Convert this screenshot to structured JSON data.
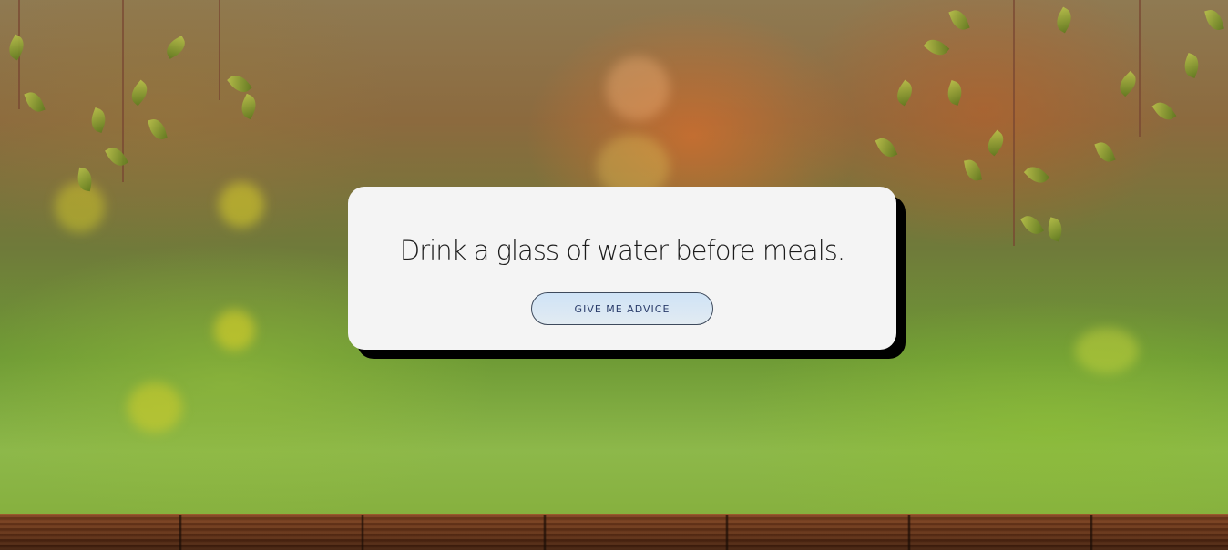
{
  "advice": {
    "text": "Drink a glass of water before meals.",
    "button_label": "GIVE ME ADVICE"
  },
  "colors": {
    "card_background": "#f4f4f4",
    "card_shadow": "#000000",
    "button_border": "#3e4a5c",
    "button_text": "#2a3c6a"
  }
}
